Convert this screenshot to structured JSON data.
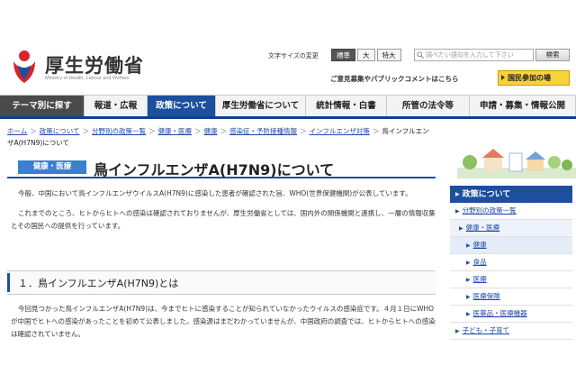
{
  "header": {
    "site_title": "厚生労働省",
    "site_subtitle": "Ministry of Health, Labour and Welfare",
    "font_size_label": "文字サイズの変更",
    "font_size_options": [
      "標準",
      "大",
      "特大"
    ],
    "search_placeholder": "調べたい語句を入力して下さい",
    "search_button": "検索",
    "public_comment_link": "ご意見募集やパブリックコメントはこちら",
    "participation_button": "国民参加の場"
  },
  "nav": {
    "items": [
      "テーマ別に探す",
      "報道・広報",
      "政策について",
      "厚生労働省について",
      "統計情報・白書",
      "所管の法令等",
      "申請・募集・情報公開"
    ],
    "active_index": 2
  },
  "breadcrumb": {
    "items": [
      "ホーム",
      "政策について",
      "分野別の政策一覧",
      "健康・医療",
      "健康",
      "感染症・予防接種情報",
      "インフルエンザ対策",
      "鳥インフルエンザA(H7N9)について"
    ]
  },
  "page": {
    "category_badge": "健康・医療",
    "title": "鳥インフルエンザA(H7N9)について",
    "para1": "今般、中国において鳥インフルエンザウイルスA(H7N9)に感染した患者が確認された旨、WHO(世界保健機関)が公表しています。",
    "para2": "これまでのところ、ヒトからヒトへの感染は確認されておりませんが、厚生労働省としては、国内外の関係機関と連携し、一層の情報収集とその国民への提供を行っています。",
    "section1_title": "１．鳥インフルエンザA(H7N9)とは",
    "para3": "今回見つかった鳥インフルエンザA(H7N9)は、今までヒトに感染することが知られていなかったウイルスの感染症です。４月１日にWHOが中国でヒトへの感染があったことを初めて公表しました。感染源はまだわかっていませんが、中国政府の調査では、ヒトからヒトへの感染は確認されていません。"
  },
  "sidebar": {
    "heading": "政策について",
    "items": [
      "分野別の政策一覧",
      "健康・医療",
      "健康",
      "食品",
      "医療",
      "医療保険",
      "医薬品・医療機器",
      "子ども・子育て"
    ]
  },
  "colors": {
    "nav_active": "#1d4f9f",
    "badge": "#3b7ed2",
    "link": "#1f4aa8",
    "participation_button": "#f8d23a"
  }
}
